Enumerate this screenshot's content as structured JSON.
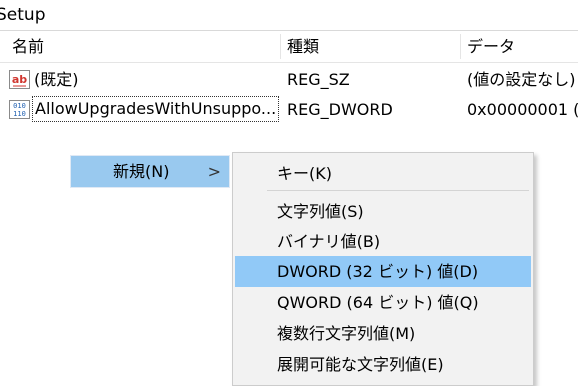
{
  "path": {
    "text": "Setup"
  },
  "columns": {
    "name": "名前",
    "type": "種類",
    "data": "データ"
  },
  "rows": [
    {
      "icon": "string-value-icon",
      "name": "(既定)",
      "type": "REG_SZ",
      "data": "(値の設定なし)"
    },
    {
      "icon": "binary-value-icon",
      "name": "AllowUpgradesWithUnsuppo...",
      "type": "REG_DWORD",
      "data": "0x00000001 (1"
    }
  ],
  "context_menu": {
    "parent_label": "新規(N)",
    "parent_arrow": ">",
    "items": [
      {
        "label": "キー(K)"
      },
      {
        "label": "文字列値(S)"
      },
      {
        "label": "バイナリ値(B)"
      },
      {
        "label": "DWORD (32 ビット) 値(D)"
      },
      {
        "label": "QWORD (64 ビット) 値(Q)"
      },
      {
        "label": "複数行文字列値(M)"
      },
      {
        "label": "展開可能な文字列値(E)"
      }
    ],
    "highlighted_item": "DWORD (32 ビット) 値(D)"
  },
  "colors": {
    "menu_background": "#f2f2f2",
    "highlight": "#91c9f7",
    "parent_highlight": "#99c9ef",
    "string_icon_red": "#d0362f",
    "binary_icon_blue": "#1f5fb0"
  }
}
